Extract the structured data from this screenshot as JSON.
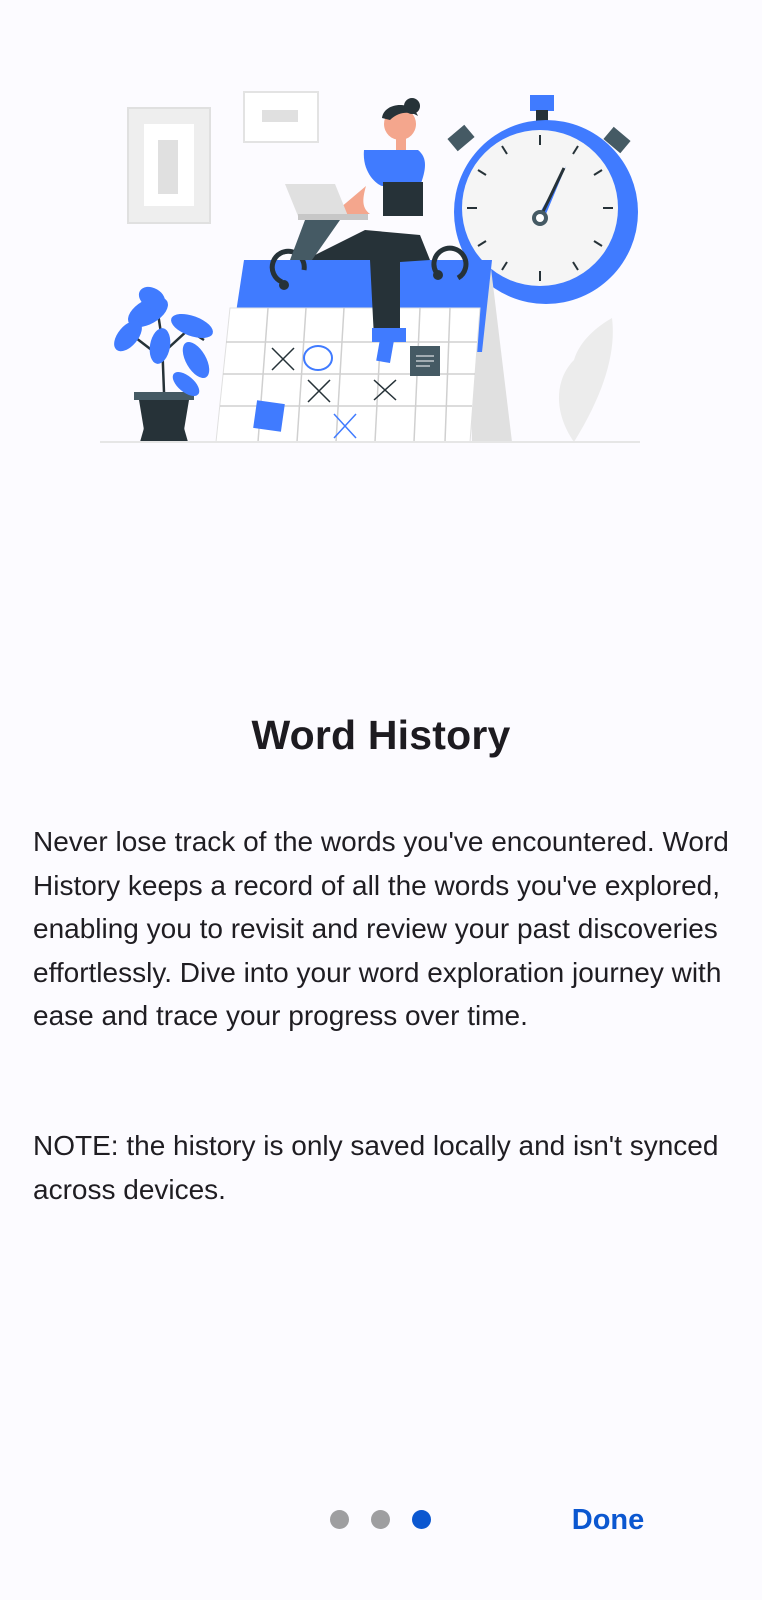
{
  "onboarding": {
    "title": "Word History",
    "description": "Never lose track of the words you've encountered. Word History keeps a record of all the words you've explored, enabling you to revisit and review your past discoveries effortlessly. Dive into your word exploration journey with ease and trace your progress over time.",
    "note": "NOTE: the history is only saved locally and isn't synced across devices.",
    "illustration_icon": "calendar-stopwatch-illustration"
  },
  "pager": {
    "page_count": 3,
    "active_page": 3
  },
  "actions": {
    "done_label": "Done"
  },
  "colors": {
    "accent": "#0b57d0",
    "illustration_blue": "#407bff",
    "dot_inactive": "#9e9ea0",
    "background": "#fcfbff"
  }
}
